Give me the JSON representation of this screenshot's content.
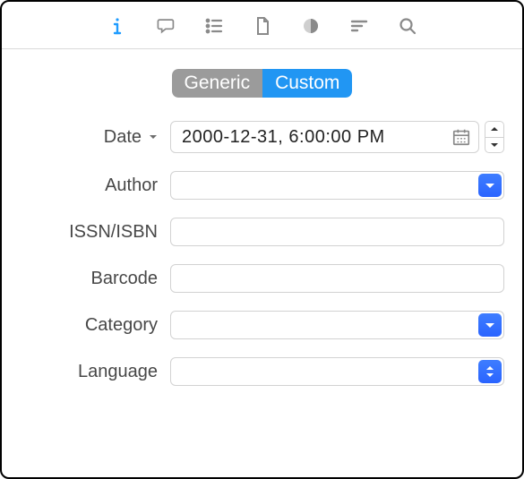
{
  "toolbar": {
    "icons": [
      "info",
      "comment",
      "outline",
      "document",
      "moon",
      "filter-lines",
      "search"
    ],
    "active_index": 0
  },
  "segmented": {
    "left": "Generic",
    "right": "Custom",
    "selected": "Custom"
  },
  "fields": {
    "date": {
      "label": "Date",
      "value": "2000-12-31,  6:00:00 PM"
    },
    "author": {
      "label": "Author",
      "value": ""
    },
    "issn": {
      "label": "ISSN/ISBN",
      "value": ""
    },
    "barcode": {
      "label": "Barcode",
      "value": ""
    },
    "category": {
      "label": "Category",
      "value": ""
    },
    "language": {
      "label": "Language",
      "value": ""
    }
  }
}
